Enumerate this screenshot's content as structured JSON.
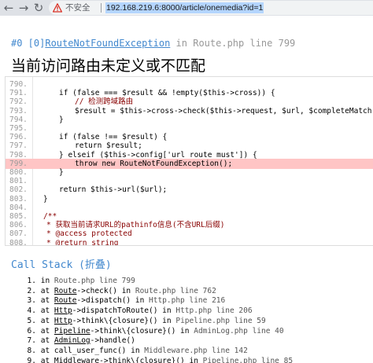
{
  "browser": {
    "back_glyph": "←",
    "forward_glyph": "→",
    "reload_glyph": "↻",
    "security_label": "不安全",
    "url": "192.168.219.6:8000/article/onemedia?id=1"
  },
  "exception": {
    "prefix": "#0 [0]",
    "name": "RouteNotFoundException",
    "in_word": " in ",
    "location": "Route.php line 799",
    "message": "当前访问路由未定义或不匹配"
  },
  "source": {
    "lines": [
      {
        "num": "790.",
        "code": "",
        "type": "code"
      },
      {
        "num": "791.",
        "code": "if (false === $result && !empty($this->cross)) {",
        "type": "code"
      },
      {
        "num": "792.",
        "code": "// 检测跨域路由",
        "type": "comment"
      },
      {
        "num": "793.",
        "code": "$result = $this->cross->check($this->request, $url, $completeMatch);",
        "type": "code"
      },
      {
        "num": "794.",
        "code": "}",
        "type": "code"
      },
      {
        "num": "795.",
        "code": "",
        "type": "code"
      },
      {
        "num": "796.",
        "code": "if (false !== $result) {",
        "type": "code"
      },
      {
        "num": "797.",
        "code": "return $result;",
        "type": "code"
      },
      {
        "num": "798.",
        "code": "} elseif ($this->config['url_route_must']) {",
        "type": "code"
      },
      {
        "num": "799.",
        "code": "throw new RouteNotFoundException();",
        "type": "code"
      },
      {
        "num": "800.",
        "code": "}",
        "type": "code"
      },
      {
        "num": "801.",
        "code": "",
        "type": "code"
      },
      {
        "num": "802.",
        "code": "return $this->url($url);",
        "type": "code"
      },
      {
        "num": "803.",
        "code": "}",
        "type": "code"
      },
      {
        "num": "804.",
        "code": "",
        "type": "code"
      },
      {
        "num": "805.",
        "code": "/**",
        "type": "comment"
      },
      {
        "num": "806.",
        "code": "* 获取当前请求URL的pathinfo信息(不含URL后缀)",
        "type": "comment"
      },
      {
        "num": "807.",
        "code": "* @access protected",
        "type": "comment"
      },
      {
        "num": "808.",
        "code": "* @return string",
        "type": "comment"
      }
    ],
    "highlight_color": "#ffc5c5"
  },
  "call_stack": {
    "title": "Call Stack (折叠)",
    "items": [
      {
        "num": "1.",
        "pre": " in ",
        "cls": "",
        "rest": "",
        "loc": "Route.php line 799"
      },
      {
        "num": "2.",
        "pre": " at ",
        "cls": "Route",
        "rest": "->check() in ",
        "loc": "Route.php line 762"
      },
      {
        "num": "3.",
        "pre": " at ",
        "cls": "Route",
        "rest": "->dispatch() in ",
        "loc": "Http.php line 216"
      },
      {
        "num": "4.",
        "pre": " at ",
        "cls": "Http",
        "rest": "->dispatchToRoute() in ",
        "loc": "Http.php line 206"
      },
      {
        "num": "5.",
        "pre": " at ",
        "cls": "Http",
        "rest": "->think\\{closure}() in ",
        "loc": "Pipeline.php line 59"
      },
      {
        "num": "6.",
        "pre": " at ",
        "cls": "Pipeline",
        "rest": "->think\\{closure}() in ",
        "loc": "AdminLog.php line 40"
      },
      {
        "num": "7.",
        "pre": " at ",
        "cls": "AdminLog",
        "rest": "->handle()",
        "loc": ""
      },
      {
        "num": "8.",
        "pre": " at ",
        "cls": "",
        "rest": "call_user_func() in ",
        "loc": "Middleware.php line 142"
      },
      {
        "num": "9.",
        "pre": " at ",
        "cls": "Middleware",
        "rest": "->think\\{closure}() in ",
        "loc": "Pipeline.php line 85"
      }
    ]
  },
  "colors": {
    "link_blue": "#4288ce",
    "comment_red": "#880000",
    "warning_red": "#d93025"
  }
}
